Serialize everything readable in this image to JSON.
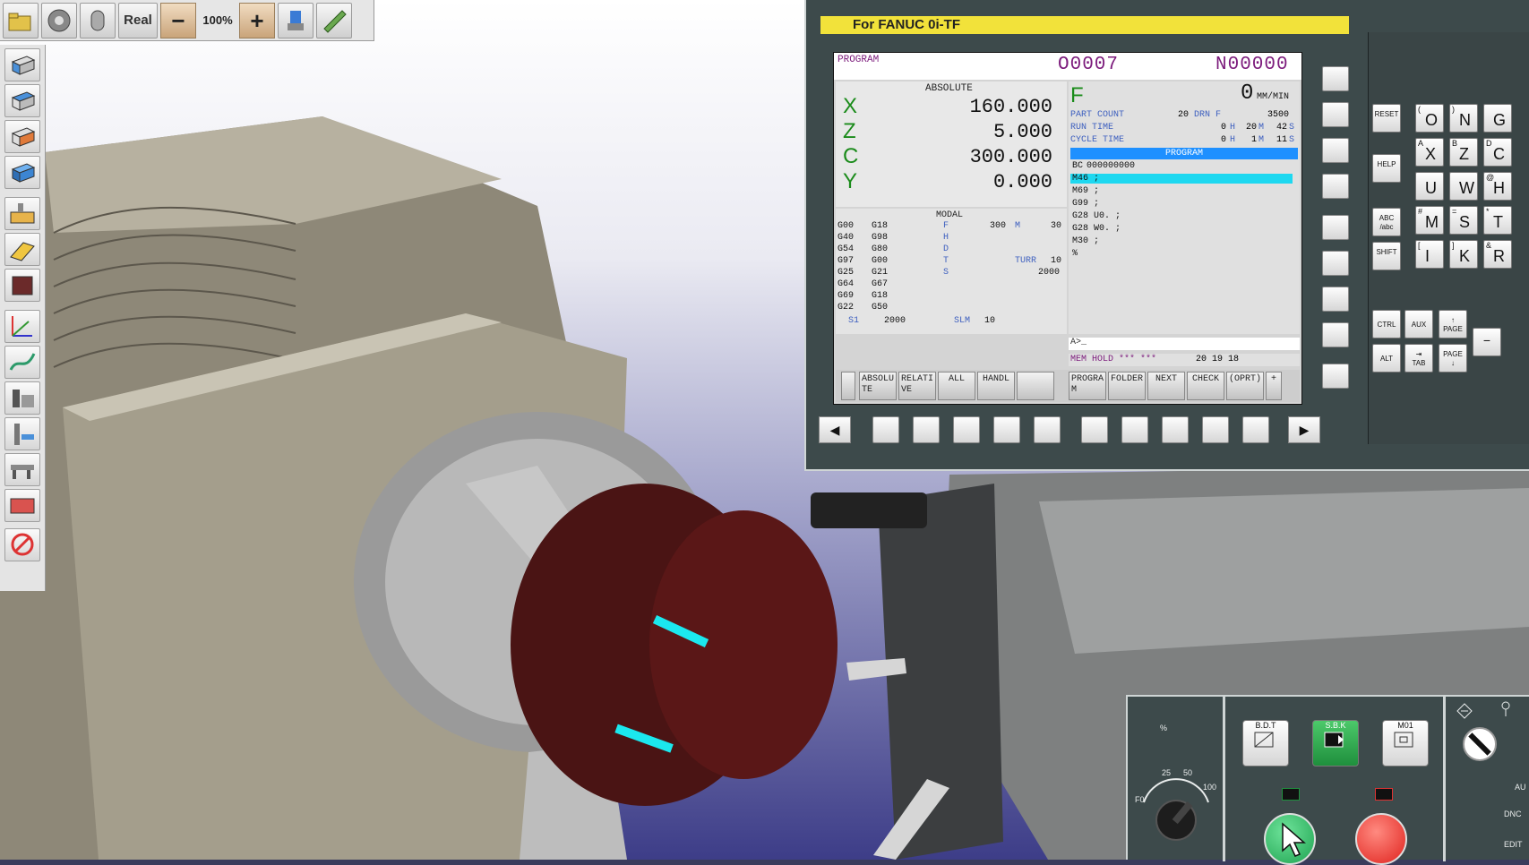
{
  "toolbar": {
    "speed_label": "Real",
    "minus_label": "−",
    "zoom_level": "100%",
    "plus_label": "+"
  },
  "left_toolbar": {
    "tools": [
      "view-front",
      "view-top",
      "view-side",
      "view-iso",
      "machine",
      "workpiece",
      "stock",
      "coordinate-system",
      "toolpath",
      "measure",
      "setup",
      "calipers",
      "material",
      "stop"
    ]
  },
  "cnc": {
    "title": "For FANUC 0i-TF",
    "screen": {
      "program_label": "PROGRAM",
      "o_number": "O0007",
      "n_number": "N00000",
      "absolute_title": "ABSOLUTE",
      "axes": [
        {
          "name": "X",
          "value": "160.000"
        },
        {
          "name": "Z",
          "value": "5.000"
        },
        {
          "name": "C",
          "value": "300.000"
        },
        {
          "name": "Y",
          "value": "0.000"
        }
      ],
      "feed_label": "F",
      "feed_value": "0",
      "feed_unit": "MM/MIN",
      "part_count_label": "PART COUNT",
      "part_count_value": "20",
      "drn_label": "DRN F",
      "drn_value": "3500",
      "run_time_label": "RUN TIME",
      "run_time_h": "0",
      "run_time_m": "20",
      "run_time_s": "42",
      "cycle_time_label": "CYCLE TIME",
      "cycle_time_h": "0",
      "cycle_time_m": "1",
      "cycle_time_s": "11",
      "h_unit": "H",
      "m_unit": "M",
      "s_unit": "S",
      "program_title": "PROGRAM",
      "program_lines": [
        {
          "prefix": "BC",
          "text": "000000000"
        },
        {
          "text": "M46 ;"
        },
        {
          "text": "M69 ;"
        },
        {
          "text": "G99 ;"
        },
        {
          "text": "G28 U0. ;"
        },
        {
          "text": "G28 W0. ;"
        },
        {
          "text": "M30 ;"
        },
        {
          "text": "%"
        }
      ],
      "modal_title": "MODAL",
      "modal_col1": [
        "G00",
        "G40",
        "G54",
        "G97",
        "G25",
        "G64",
        "G69",
        "G22"
      ],
      "modal_col2": [
        "G18",
        "G98",
        "G80",
        "G00",
        "G21",
        "G67",
        "G18",
        "G50"
      ],
      "modal_letters": [
        "F",
        "H",
        "D",
        "T",
        "S"
      ],
      "modal_f_value": "300",
      "modal_m_label": "M",
      "modal_m_value": "30",
      "modal_turr_label": "TURR",
      "modal_turr_value": "10",
      "modal_s_value": "2000",
      "s1_label": "S1",
      "s1_value": "2000",
      "slm_label": "SLM",
      "slm_value": "10",
      "input_prompt": "A>_",
      "status_mode": "MEM HOLD *** ***",
      "status_time": "20 19 18",
      "softkeys": [
        {
          "label": "ABSOLU TE"
        },
        {
          "label": "RELATI VE"
        },
        {
          "label": "ALL"
        },
        {
          "label": "HANDL"
        },
        {
          "label": ""
        },
        {
          "label": "PROGRA M"
        },
        {
          "label": "FOLDER"
        },
        {
          "label": "NEXT"
        },
        {
          "label": "CHECK"
        },
        {
          "label": "(OPRT)"
        },
        {
          "label": "+"
        }
      ]
    },
    "keys": [
      {
        "sub": "(",
        "main": "O"
      },
      {
        "sub": ")",
        "main": "N"
      },
      {
        "sub": "",
        "main": "G"
      },
      {
        "sub": "A",
        "main": "X"
      },
      {
        "sub": "B",
        "main": "Z"
      },
      {
        "sub": "D",
        "main": "C"
      },
      {
        "sub": "",
        "main": "U"
      },
      {
        "sub": "",
        "main": "W"
      },
      {
        "sub": "@",
        "main": "H"
      },
      {
        "sub": "#",
        "main": "M"
      },
      {
        "sub": "=",
        "main": "S"
      },
      {
        "sub": "*",
        "main": "T"
      },
      {
        "sub": "[",
        "main": "I"
      },
      {
        "sub": "]",
        "main": "K"
      },
      {
        "sub": "&",
        "main": "R"
      }
    ],
    "function_keys": {
      "reset": "RESET",
      "help": "HELP",
      "abc": "ABC /abc",
      "shift": "SHIFT",
      "ctrl": "CTRL",
      "aux": "AUX",
      "alt": "ALT",
      "tab": "TAB",
      "page_up": "PAGE",
      "page_down": "PAGE"
    }
  },
  "operator_panel": {
    "override_label": "%",
    "override_scale": [
      "F0",
      "25",
      "50",
      "100"
    ],
    "bdt_label": "B.D.T",
    "sbk_label": "S.B.K",
    "m01_label": "M01",
    "aux_label": "AU",
    "dnc_label": "DNC",
    "edit_label": "EDIT"
  },
  "colors": {
    "title_bar": "#f2e23a",
    "screen_highlight": "#1ed8f0",
    "program_header": "#1e90ff",
    "cycle_start": "#1fa351",
    "feed_hold": "#e0231e"
  }
}
